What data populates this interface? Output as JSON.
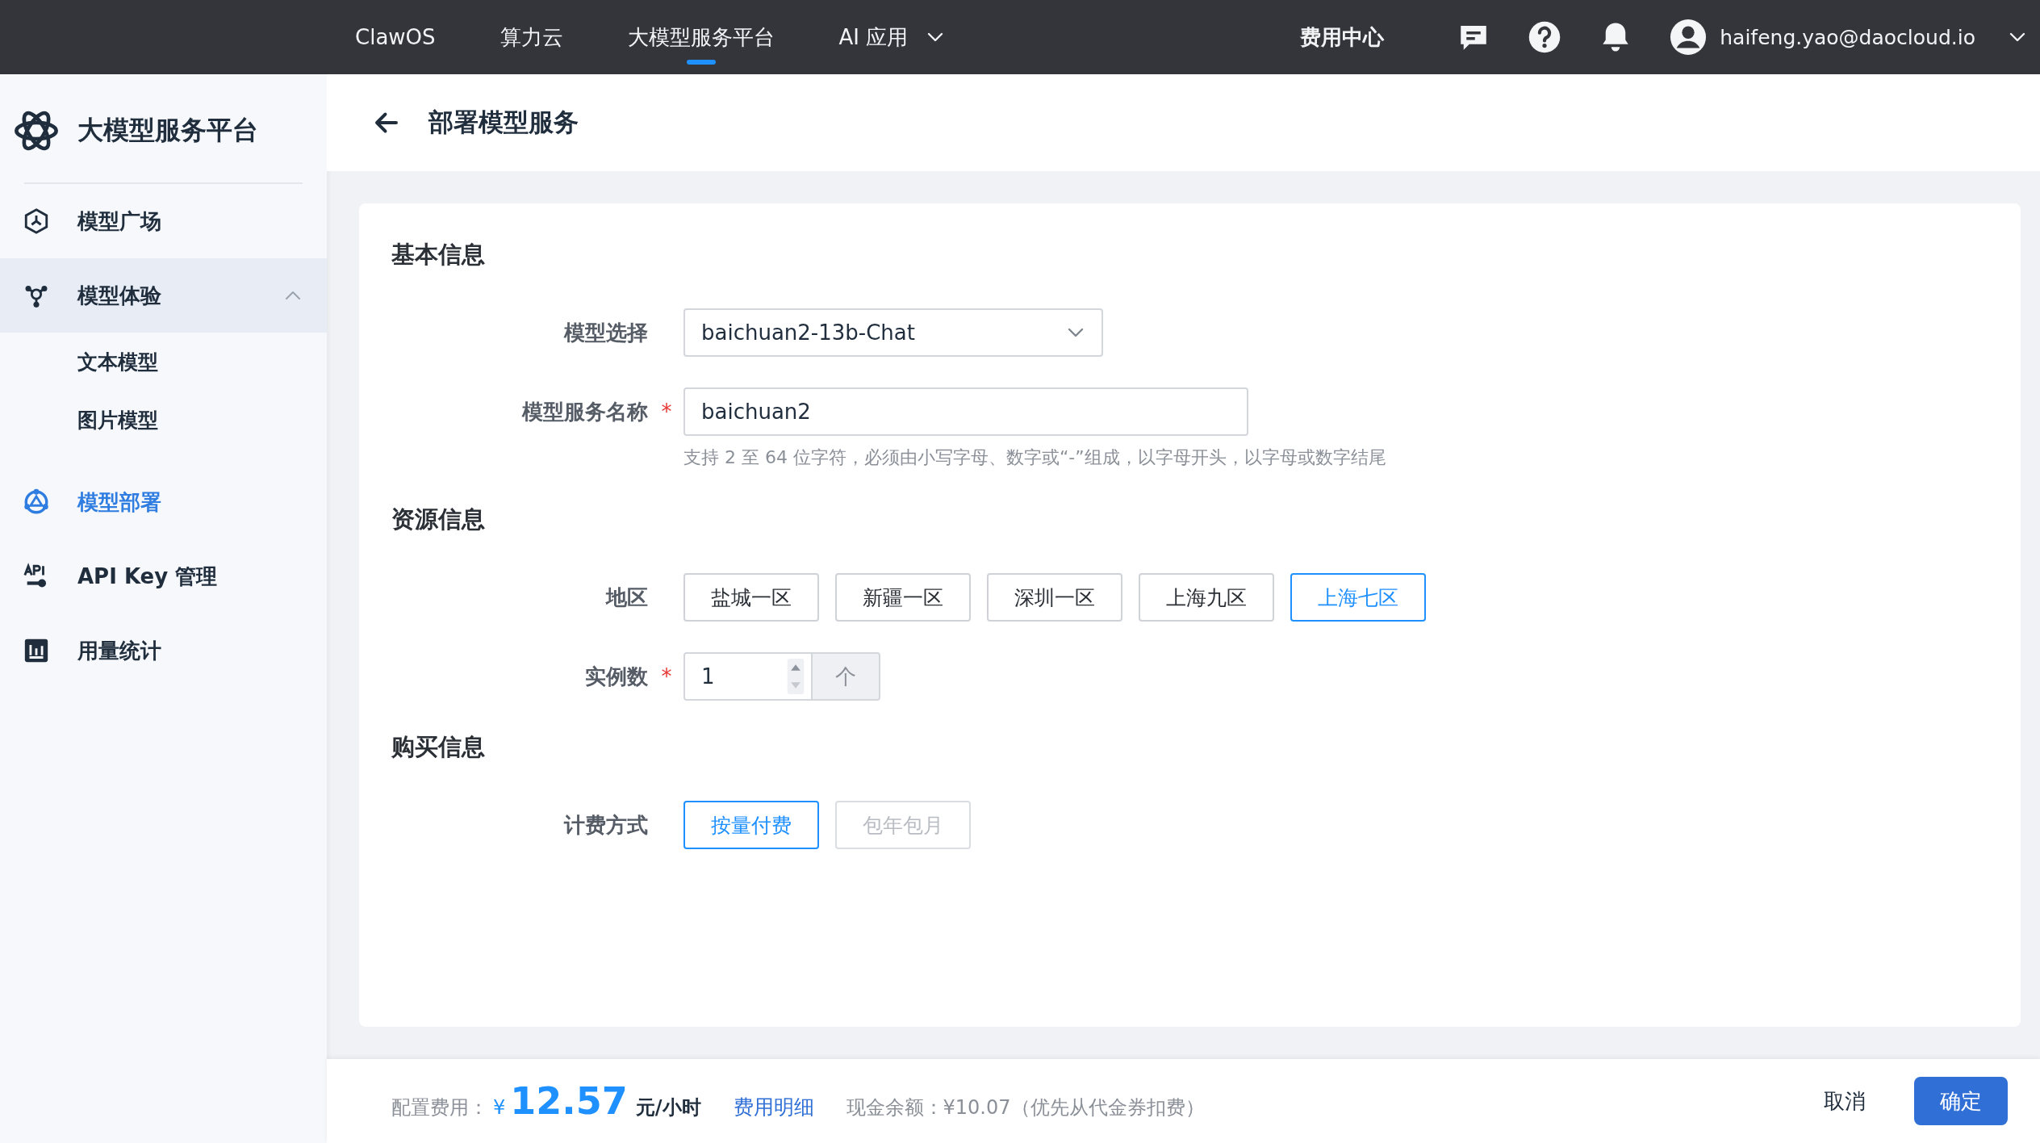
{
  "top_nav": {
    "items": [
      {
        "label": "ClawOS",
        "selected": false,
        "dropdown": false
      },
      {
        "label": "算力云",
        "selected": false,
        "dropdown": false
      },
      {
        "label": "大模型服务平台",
        "selected": true,
        "dropdown": false
      },
      {
        "label": "AI 应用",
        "selected": false,
        "dropdown": true
      }
    ],
    "billing_link": "费用中心",
    "user": "haifeng.yao@daocloud.io"
  },
  "sidebar": {
    "title": "大模型服务平台",
    "items": [
      {
        "label": "模型广场",
        "selected": false
      },
      {
        "label": "模型体验",
        "selected": false,
        "expanded": true,
        "children": [
          {
            "label": "文本模型",
            "selected": false
          },
          {
            "label": "图片模型",
            "selected": false
          }
        ]
      },
      {
        "label": "模型部署",
        "selected": true
      },
      {
        "label": "API Key 管理",
        "selected": false
      },
      {
        "label": "用量统计",
        "selected": false
      }
    ]
  },
  "page": {
    "title": "部署模型服务"
  },
  "form": {
    "sections": [
      {
        "title": "基本信息",
        "fields": [
          {
            "kind": "select",
            "label": "模型选择",
            "value": "baichuan2-13b-Chat"
          },
          {
            "kind": "text",
            "label": "模型服务名称",
            "required_mark": "*",
            "value": "baichuan2",
            "hint": "支持 2 至 64 位字符，必须由小写字母、数字或“-”组成，以字母开头，以字母或数字结尾"
          }
        ]
      },
      {
        "title": "资源信息",
        "fields": [
          {
            "kind": "options",
            "label": "地区",
            "options": [
              {
                "label": "盐城一区",
                "selected": false,
                "disabled": false
              },
              {
                "label": "新疆一区",
                "selected": false,
                "disabled": false
              },
              {
                "label": "深圳一区",
                "selected": false,
                "disabled": false
              },
              {
                "label": "上海九区",
                "selected": false,
                "disabled": false
              },
              {
                "label": "上海七区",
                "selected": true,
                "disabled": false
              }
            ]
          },
          {
            "kind": "number",
            "label": "实例数",
            "required_mark": "*",
            "value": "1",
            "unit": "个"
          }
        ]
      },
      {
        "title": "购买信息",
        "fields": [
          {
            "kind": "options",
            "label": "计费方式",
            "options": [
              {
                "label": "按量付费",
                "selected": true,
                "disabled": false
              },
              {
                "label": "包年包月",
                "selected": false,
                "disabled": true
              }
            ]
          }
        ]
      }
    ]
  },
  "footer": {
    "cost_label": "配置费用：",
    "currency": "¥",
    "price": "12.57",
    "unit": "元/小时",
    "detail_link": "费用明细",
    "balance": "现金余额：¥10.07（优先从代金券扣费）",
    "cancel": "取消",
    "confirm": "确定"
  }
}
